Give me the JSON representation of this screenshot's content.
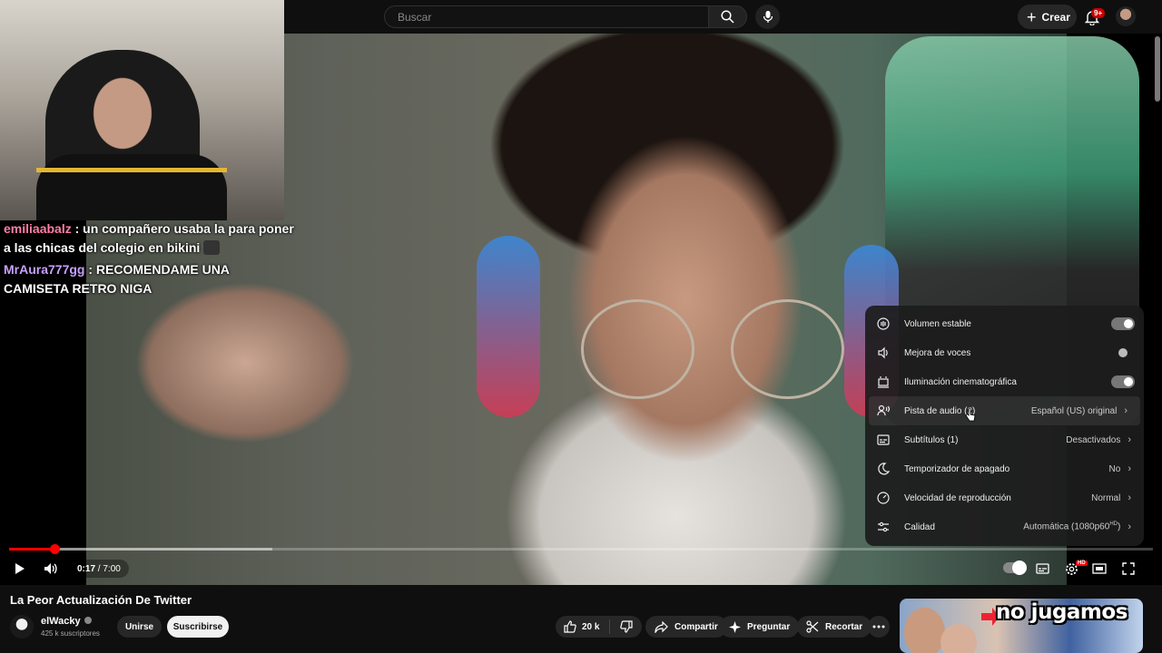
{
  "topbar": {
    "search_placeholder": "Buscar",
    "create_label": "Crear",
    "notifications_badge": "9+"
  },
  "chat": [
    {
      "user": "emiliaabalz",
      "separator": " : ",
      "text": "un compañero usaba la para poner a las chicas del colegio en bikini"
    },
    {
      "user": "MrAura777gg",
      "separator": " : ",
      "text": "RECOMENDAME UNA CAMISETA RETRO NIGA"
    }
  ],
  "settings_menu": {
    "items": [
      {
        "label": "Volumen estable",
        "icon": "stable-volume-icon",
        "toggle": true
      },
      {
        "label": "Mejora de voces",
        "icon": "voice-boost-icon",
        "toggle": false
      },
      {
        "label": "Iluminación cinematográfica",
        "icon": "ambient-mode-icon",
        "toggle": true
      },
      {
        "label": "Pista de audio (2)",
        "icon": "audio-track-icon",
        "value": "Español (US) original"
      },
      {
        "label": "Subtítulos (1)",
        "icon": "subtitles-icon",
        "value": "Desactivados"
      },
      {
        "label": "Temporizador de apagado",
        "icon": "sleep-timer-icon",
        "value": "No"
      },
      {
        "label": "Velocidad de reproducción",
        "icon": "speed-icon",
        "value": "Normal"
      },
      {
        "label": "Calidad",
        "icon": "quality-icon",
        "value": "Automática (1080p60",
        "value_sup": "HD",
        "value_suffix": ")"
      }
    ]
  },
  "player": {
    "current_time": "0:17",
    "time_separator": " / ",
    "duration": "7:00",
    "progress_fraction": 0.04,
    "buffered_fraction": 0.23,
    "quality_badge": "HD"
  },
  "video": {
    "title": "La Peor Actualización De Twitter",
    "channel_name": "elWacky",
    "subscribers": "425 k suscriptores",
    "join_label": "Unirse",
    "subscribe_label": "Suscribirse",
    "likes": "20 k",
    "share_label": "Compartir",
    "ask_label": "Preguntar",
    "clip_label": "Recortar"
  },
  "recommended": {
    "thumbnail_text": "no jugamos"
  },
  "colors": {
    "accent_red": "#ff0000",
    "background": "#0f0f0f",
    "chip": "#272727"
  }
}
